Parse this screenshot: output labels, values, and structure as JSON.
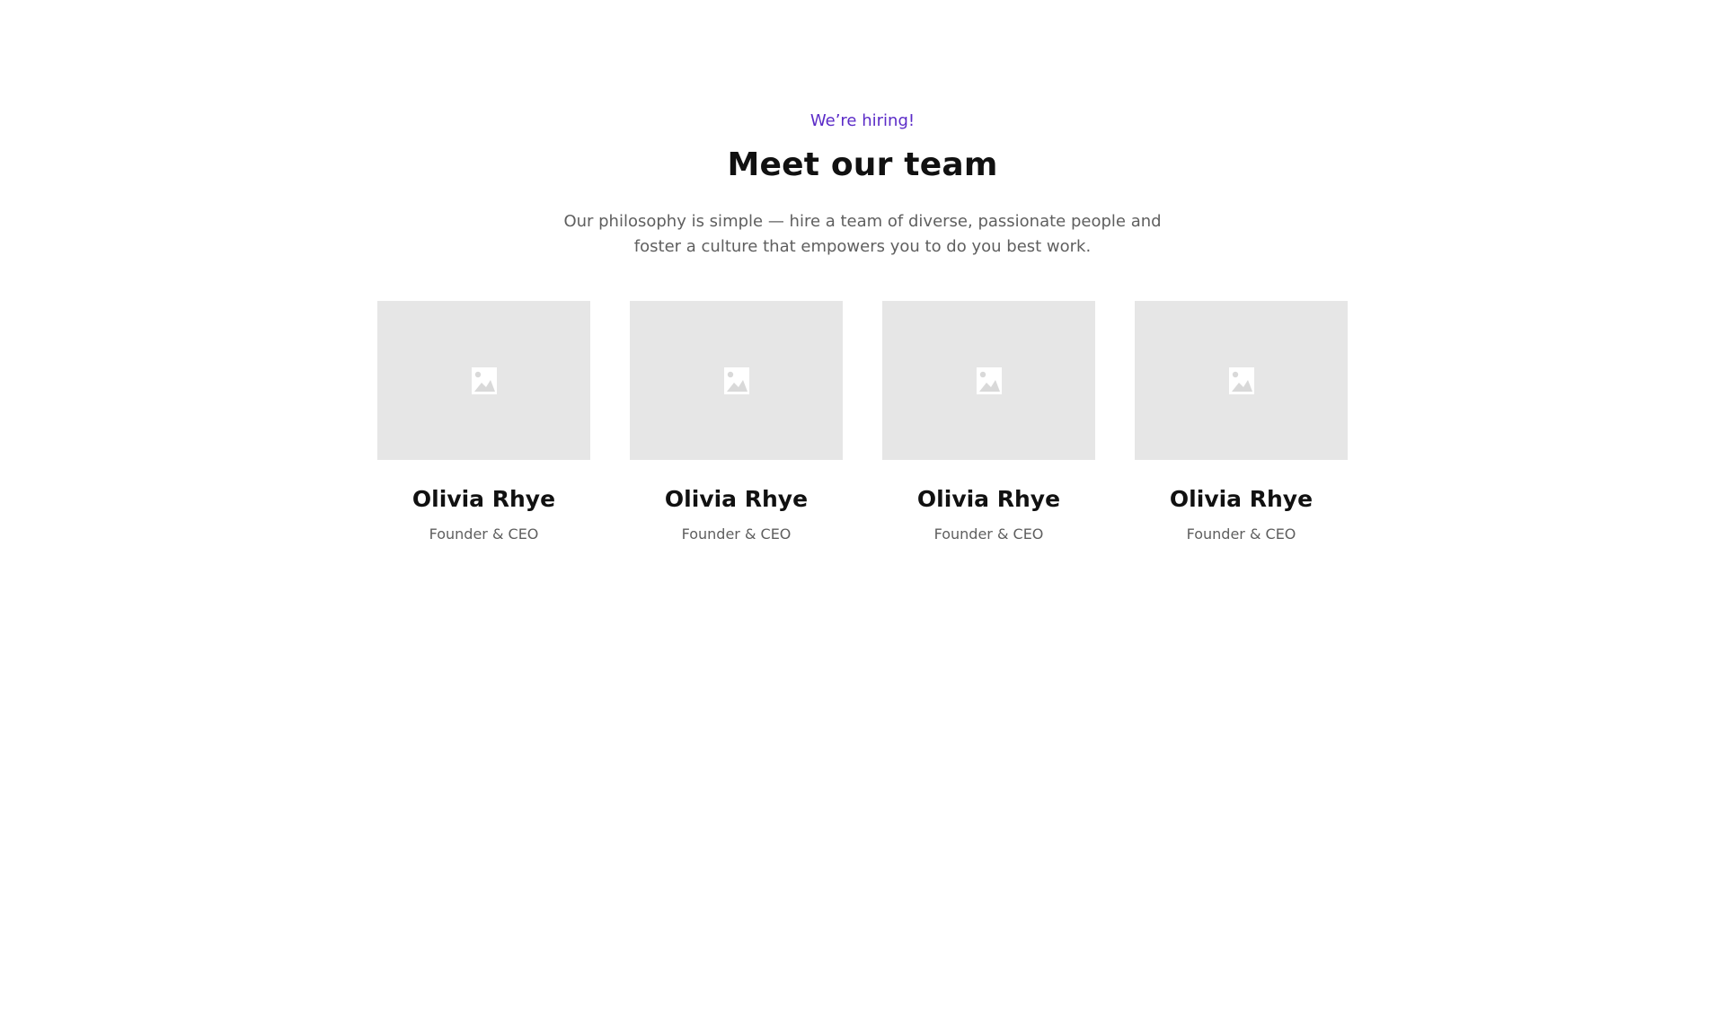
{
  "header": {
    "eyebrow": "We’re hiring!",
    "title": "Meet our team",
    "subtitle": "Our philosophy is simple — hire a team of diverse, passionate people and foster a culture that empowers you to do you best work."
  },
  "team": [
    {
      "name": "Olivia Rhye",
      "role": "Founder & CEO",
      "photo_icon": "image-placeholder-icon"
    },
    {
      "name": "Olivia Rhye",
      "role": "Founder & CEO",
      "photo_icon": "image-placeholder-icon"
    },
    {
      "name": "Olivia Rhye",
      "role": "Founder & CEO",
      "photo_icon": "image-placeholder-icon"
    },
    {
      "name": "Olivia Rhye",
      "role": "Founder & CEO",
      "photo_icon": "image-placeholder-icon"
    }
  ],
  "colors": {
    "accent": "#5b2bc7",
    "heading": "#111111",
    "muted_text": "#5f5f5f",
    "photo_background": "#e6e6e6",
    "background": "#ffffff"
  }
}
